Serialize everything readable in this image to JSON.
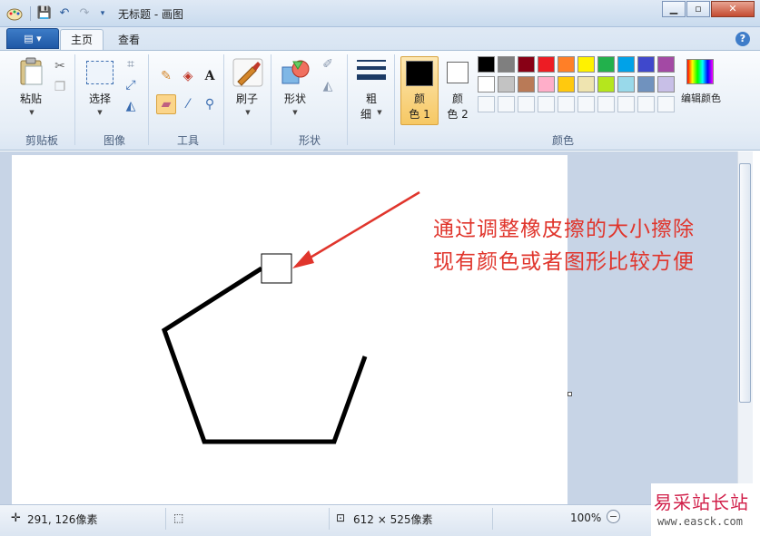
{
  "window": {
    "title": "无标题 - 画图"
  },
  "ribbon_tabs": {
    "home": "主页",
    "view": "查看"
  },
  "clipboard": {
    "paste": "粘贴",
    "group": "剪贴板"
  },
  "image": {
    "select": "选择",
    "group": "图像"
  },
  "tools": {
    "group": "工具"
  },
  "brushes": {
    "label": "刷子"
  },
  "shapes": {
    "label": "形状",
    "group": "形状"
  },
  "size": {
    "line1": "粗",
    "line2": "细"
  },
  "colors": {
    "color1_line1": "颜",
    "color1_line2": "色 1",
    "color2_line1": "颜",
    "color2_line2": "色 2",
    "edit": "编辑颜色",
    "group": "颜色",
    "primary": "#000000",
    "secondary": "#ffffff",
    "row1": [
      "#000000",
      "#7f7f7f",
      "#880015",
      "#ed1c24",
      "#ff7f27",
      "#fff200",
      "#22b14c",
      "#00a2e8",
      "#3f48cc",
      "#a349a4"
    ],
    "row2": [
      "#ffffff",
      "#c3c3c3",
      "#b97a57",
      "#ffaec9",
      "#ffc90e",
      "#efe4b0",
      "#b5e61d",
      "#99d9ea",
      "#7092be",
      "#c8bfe7"
    ]
  },
  "annotation": {
    "line1": "通过调整橡皮擦的大小擦除",
    "line2": "现有颜色或者图形比较方便"
  },
  "status": {
    "cursor_pos": "291, 126像素",
    "canvas_size": "612 × 525像素",
    "zoom": "100%"
  },
  "watermark": {
    "title": "易采站长站",
    "url": "www.easck.com"
  }
}
